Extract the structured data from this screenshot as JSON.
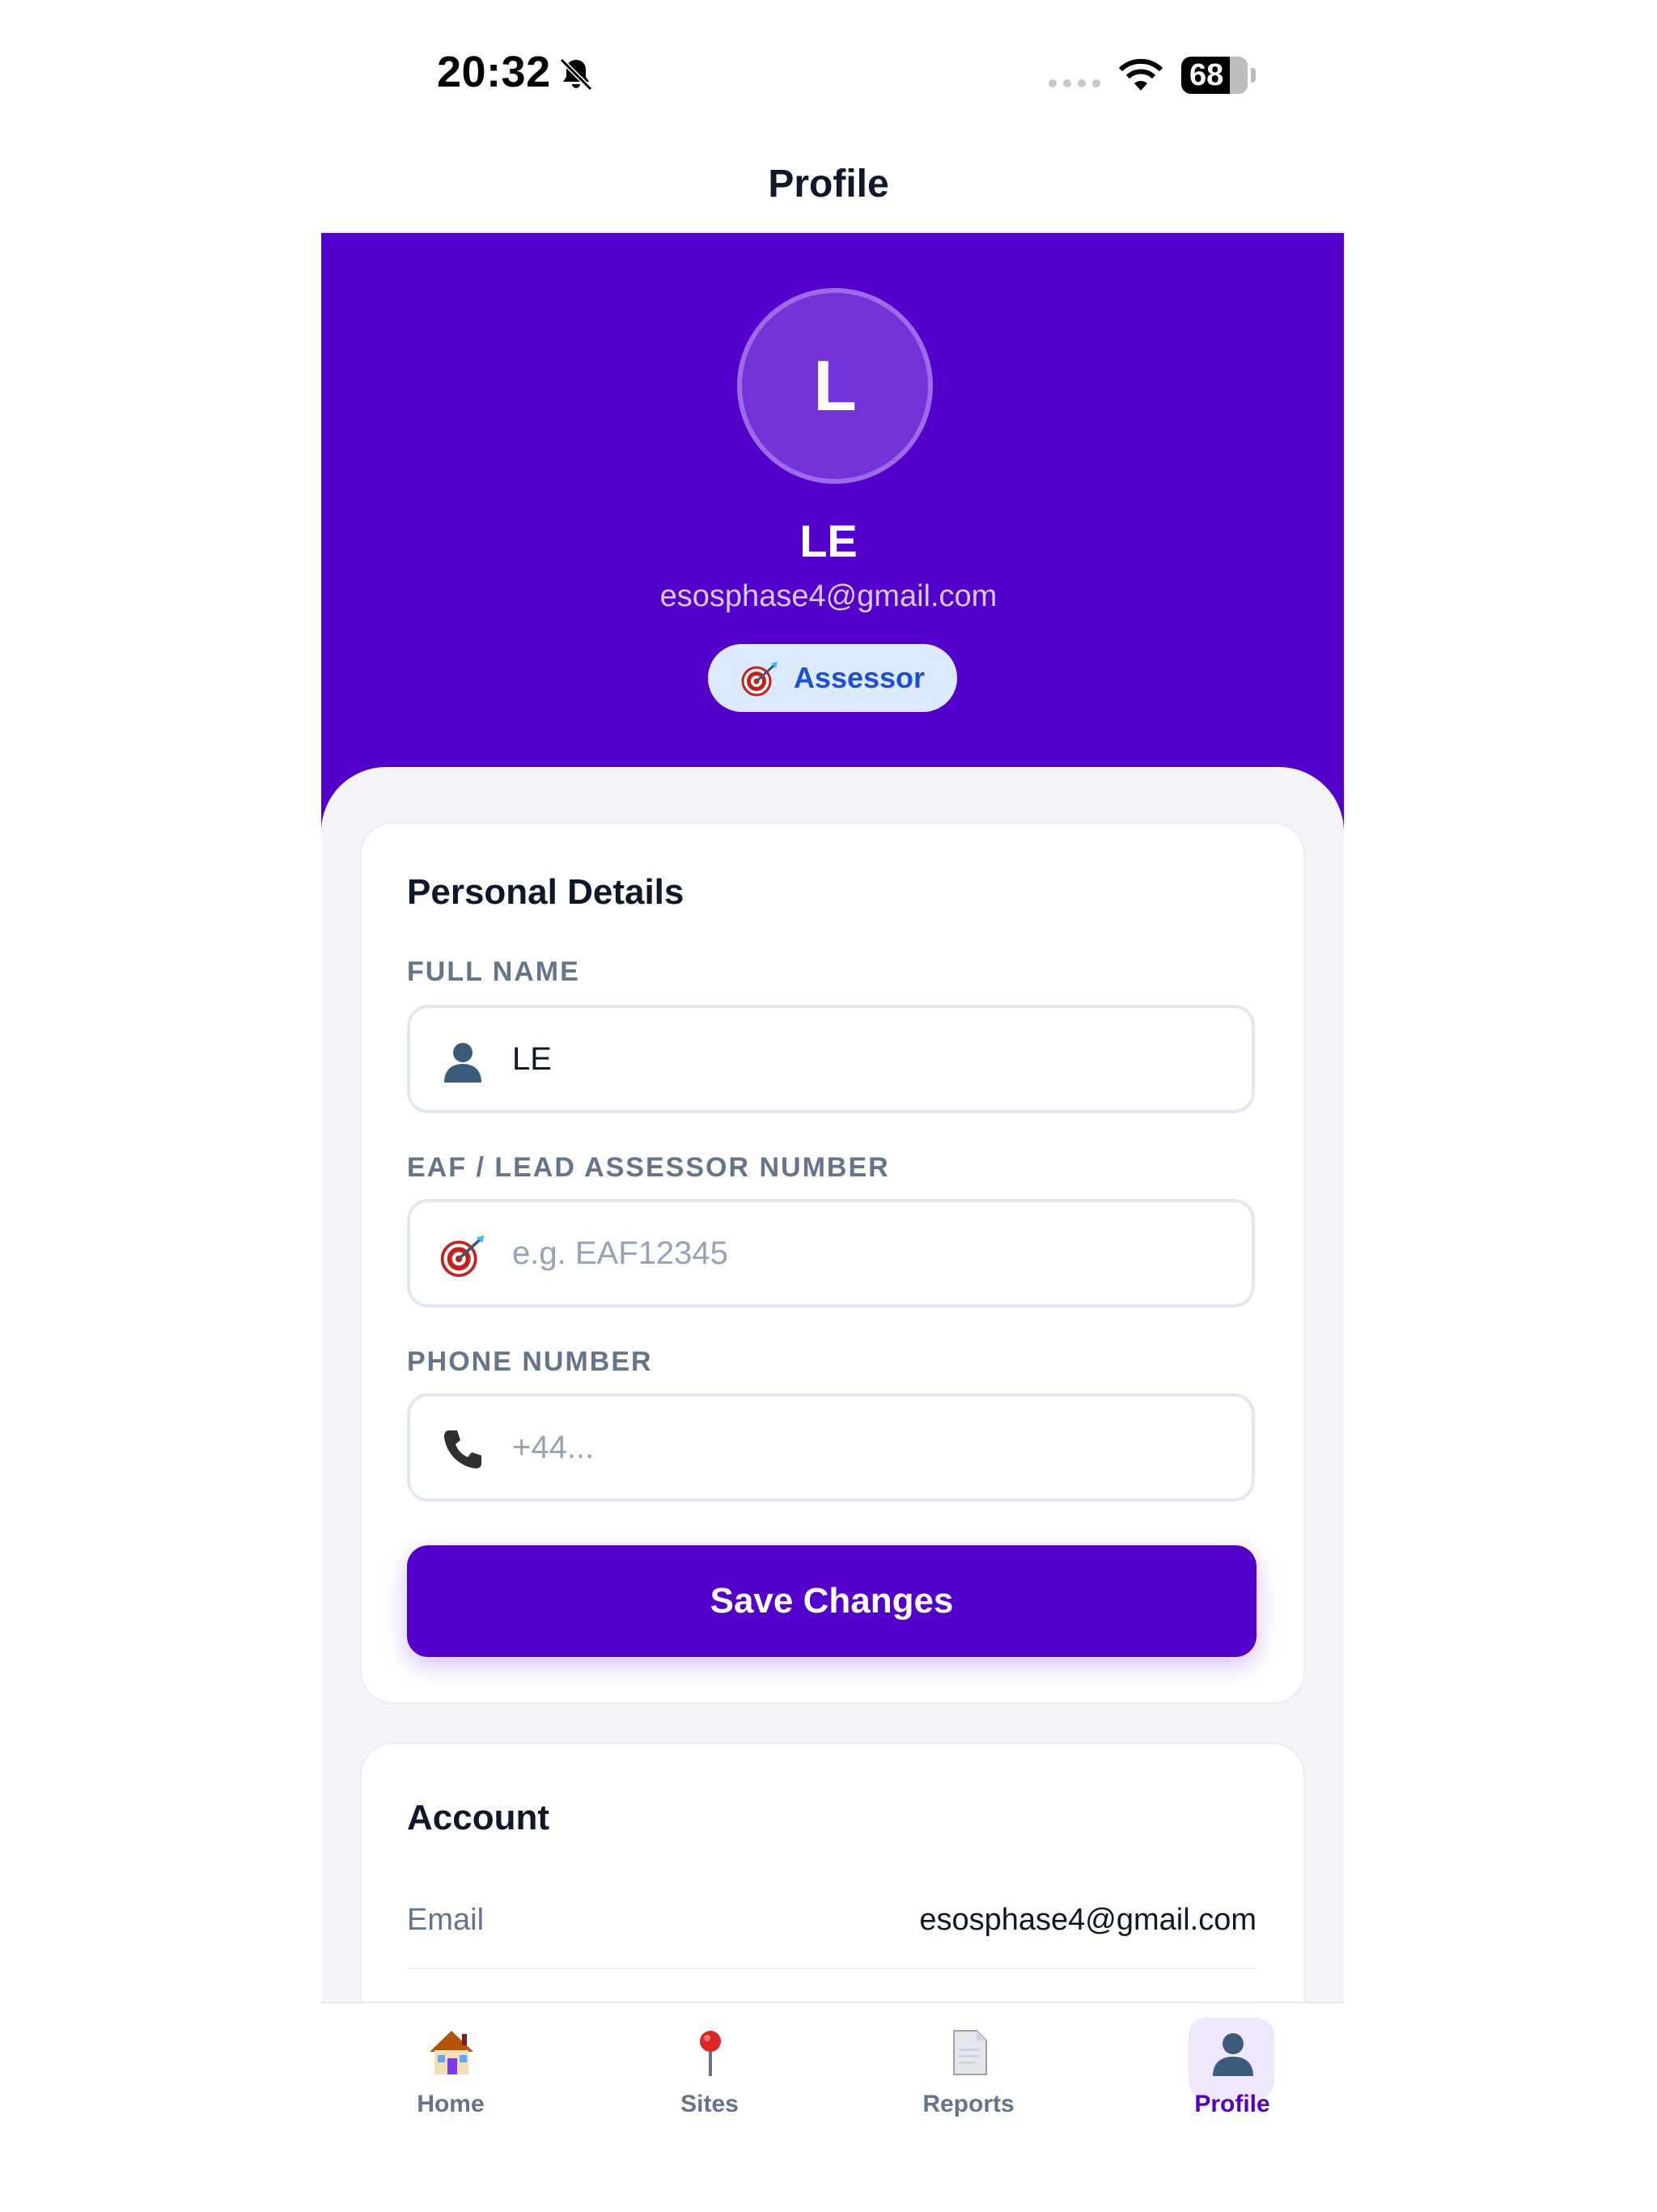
{
  "status_bar": {
    "time": "20:32",
    "battery": "68",
    "icons": [
      "bell-slash-icon",
      "signal-icon",
      "wifi-icon",
      "battery-icon"
    ]
  },
  "nav": {
    "title": "Profile"
  },
  "profile": {
    "initial": "L",
    "name": "LE",
    "email": "esosphase4@gmail.com",
    "role": "Assessor",
    "role_icon": "target-icon"
  },
  "personal_details": {
    "title": "Personal Details",
    "full_name": {
      "label": "FULL NAME",
      "value": "LE",
      "icon": "person-icon"
    },
    "assessor_number": {
      "label": "EAF / LEAD ASSESSOR NUMBER",
      "placeholder": "e.g. EAF12345",
      "value": "",
      "icon": "target-icon"
    },
    "phone": {
      "label": "PHONE NUMBER",
      "placeholder": "+44...",
      "value": "",
      "icon": "phone-icon"
    },
    "save_label": "Save Changes"
  },
  "account": {
    "title": "Account",
    "rows": [
      {
        "label": "Email",
        "value": "esosphase4@gmail.com"
      }
    ]
  },
  "tabs": [
    {
      "label": "Home",
      "icon": "house-icon",
      "active": false
    },
    {
      "label": "Sites",
      "icon": "pin-icon",
      "active": false
    },
    {
      "label": "Reports",
      "icon": "document-icon",
      "active": false
    },
    {
      "label": "Profile",
      "icon": "person-icon",
      "active": true
    }
  ],
  "colors": {
    "brand": "#5400cc",
    "badge_bg": "#dbeafe",
    "badge_text": "#1d4ed8",
    "content_bg": "#f4f3f7"
  }
}
